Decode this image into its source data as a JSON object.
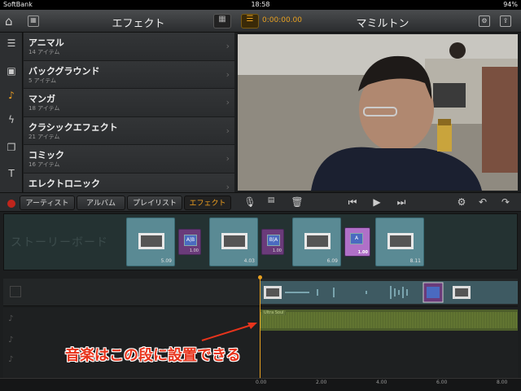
{
  "status": {
    "carrier": "SoftBank",
    "time": "18:58",
    "battery": "94%"
  },
  "topbar": {
    "title": "エフェクト",
    "timecode": "0:00:00.00",
    "project": "マミルトン"
  },
  "icons": {
    "home": "home-icon",
    "grid": "grid-icon",
    "view": "view-icon",
    "clock": "timecode-icon",
    "share": "share-icon",
    "settings": "settings-icon"
  },
  "sidebar": [
    "list-icon",
    "photo-icon",
    "music-icon",
    "lightning-icon",
    "clips-icon",
    "text-icon"
  ],
  "effects_list": [
    {
      "name": "アニマル",
      "count": "14 アイテム"
    },
    {
      "name": "バックグラウンド",
      "count": "5 アイテム"
    },
    {
      "name": "マンガ",
      "count": "18 アイテム"
    },
    {
      "name": "クラシックエフェクト",
      "count": "21 アイテム"
    },
    {
      "name": "コミック",
      "count": "16 アイテム"
    },
    {
      "name": "エレクトロニック",
      "count": ""
    }
  ],
  "tabs": [
    {
      "label": "アーティスト",
      "active": false
    },
    {
      "label": "アルバム",
      "active": false
    },
    {
      "label": "プレイリスト",
      "active": false
    },
    {
      "label": "エフェクト",
      "active": true
    }
  ],
  "storyboard": {
    "label": "ストーリーボード",
    "clips": [
      {
        "duration": "5.09"
      },
      {
        "duration": "4.03"
      },
      {
        "duration": "6.09"
      },
      {
        "duration": "8.11"
      }
    ],
    "transitions": [
      {
        "duration": "1.00"
      },
      {
        "duration": "1.00"
      },
      {
        "duration": "1.00"
      }
    ]
  },
  "audio": {
    "track_tag": "Ultra Soul"
  },
  "ruler": [
    "0.00",
    "2.00",
    "4.00",
    "6.00",
    "8.00"
  ],
  "annotation": "音楽はこの段に設置できる",
  "colors": {
    "accent": "#e8a020",
    "annotation": "#e8341c",
    "storyboard_bg": "#243232",
    "clip": "#5a8a94",
    "transition": "#6a3b7a"
  }
}
